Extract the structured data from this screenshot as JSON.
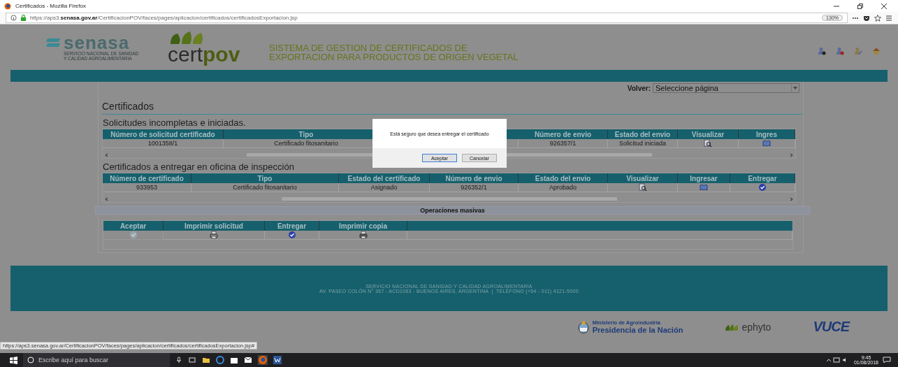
{
  "browser": {
    "title": "Certificados - Mozilla Firefox",
    "url": "https://aps3.**senasa.gov.ar**/CertificacionPOV/faces/pages/aplicacion/certificados/certificadosExportacion.jsp",
    "zoom": "130%"
  },
  "header": {
    "logo_text": "senasa",
    "logo_subtitle": [
      "SERVICIO NACIONAL DE SANIDAD",
      "Y CALIDAD AGROALIMENTARIA"
    ],
    "product": {
      "prefix": "cert",
      "suffix": "pov"
    },
    "title_lines": [
      "SISTEMA DE GESTION DE CERTIFICADOS DE",
      "EXPORTACION PARA PRODUCTOS DE ORIGEN VEGETAL"
    ]
  },
  "nav": {
    "label": "Volver:",
    "select": "Seleccione página"
  },
  "page_title": "Certificados",
  "pending": {
    "title": "Solicitudes incompletas e iniciadas.",
    "columns": [
      "Número de solicitud certificado",
      "Tipo",
      "Número de envio",
      "Estado del envio",
      "Visualizar",
      "Ingres"
    ],
    "rows": [
      {
        "cells": [
          {
            "kind": "text",
            "text": "1001358/1"
          },
          {
            "kind": "text",
            "text": "Certificado fitosanitario"
          },
          {
            "kind": "text",
            "text": "926357/1"
          },
          {
            "kind": "text",
            "text": "Solicitud iniciada"
          },
          {
            "kind": "view"
          },
          {
            "kind": "enter"
          }
        ]
      }
    ]
  },
  "deliver": {
    "title": "Certificados a entregar en oficina de inspección",
    "columns": [
      "Número de certificado",
      "Tipo",
      "Estado del certificado",
      "Número de envio",
      "Estado del envio",
      "Visualizar",
      "Ingresar",
      "Entregar"
    ],
    "rows": [
      {
        "cells": [
          {
            "kind": "text",
            "text": "933953"
          },
          {
            "kind": "text",
            "text": "Certificado fitosanitario"
          },
          {
            "kind": "text",
            "text": "Asignado"
          },
          {
            "kind": "text",
            "text": "926352/1"
          },
          {
            "kind": "text",
            "text": "Aprobado"
          },
          {
            "kind": "view"
          },
          {
            "kind": "enter"
          },
          {
            "kind": "deliver"
          }
        ]
      }
    ]
  },
  "mass": {
    "title": "Operaciones masivas",
    "columns": [
      "Aceptar",
      "Imprimir solicitud",
      "Entregar",
      "Imprimir copia"
    ],
    "actions": [
      {
        "kind": "accept",
        "disabled": true
      },
      {
        "kind": "print",
        "disabled": false
      },
      {
        "kind": "deliver",
        "disabled": false
      },
      {
        "kind": "print_copy",
        "disabled": false
      }
    ]
  },
  "dialog": {
    "message": "Está seguro que desea entregar el certificado",
    "buttons": [
      {
        "label": "Aceptar",
        "selected": true
      },
      {
        "label": "Cancelar",
        "selected": false
      }
    ]
  },
  "footer": {
    "lines": [
      "SERVICIO NACIONAL DE SANIDAD Y CALIDAD AGROALIMENTARIA",
      "AV. PASEO COLÓN N° 367 - ACD1063 - BUENOS AIRES, ARGENTINA  |  TELÉFONO (+54 - 011) 4121-5000"
    ]
  },
  "partners": {
    "ministry": [
      "Ministerio de Agroindustria",
      "Presidencia de la Nación"
    ],
    "ephyto": "ephyto",
    "vuce": "VUCE"
  },
  "status_url": "https://aps3.senasa.gov.ar/CertificacionPOV/faces/pages/aplicacion/certificados/certificadosExportacion.jsp#",
  "taskbar": {
    "placeholder": "Escribe aquí para buscar",
    "time": "9:45",
    "date": "01/08/2018"
  }
}
